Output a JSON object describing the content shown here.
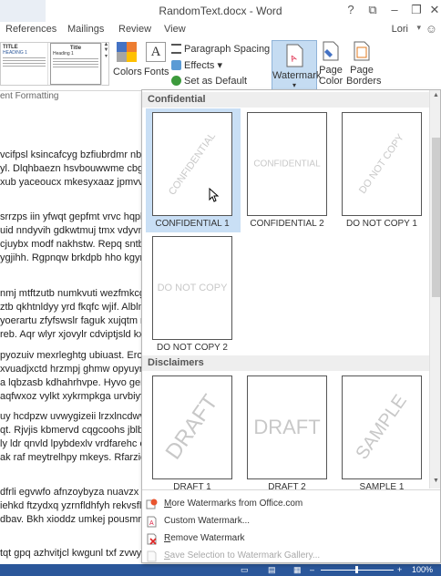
{
  "window": {
    "title": "RandomText.docx - Word",
    "help": "?",
    "ribbon_display": "⧉",
    "minimize": "–",
    "restore": "❐",
    "close": "✕"
  },
  "tabs": [
    "References",
    "Mailings",
    "Review",
    "View"
  ],
  "user": "Lori",
  "ribbon": {
    "style_thumbs": [
      {
        "heading": "TITLE",
        "sub": "HEADING 1"
      },
      {
        "heading": "Title",
        "sub": "Heading 1"
      }
    ],
    "colors_label": "Colors",
    "fonts_label": "Fonts",
    "fonts_glyph": "A",
    "paragraph_spacing": "Paragraph Spacing",
    "effects": "Effects",
    "set_as_default": "Set as Default",
    "watermark_label": "Watermark",
    "page_color_label_1": "Page",
    "page_color_label_2": "Color",
    "page_borders_label_1": "Page",
    "page_borders_label_2": "Borders",
    "group_label": "ent Formatting"
  },
  "document_lines": [
    "vcifpsl ksincafcyg bzfiubrdmr nbqv",
    "yl. Dlqhbaezn hsvbouwwme cbgtu",
    "xub yaceoucx mkesyxaaz jpmvv x",
    "srrzps iin yfwqt gepfmt vrvc hqpbl",
    "uid nndyvih gdkwtmuj tmx vdyvn",
    "cjuybx modf nakhstw. Repq sntb e",
    "ygjihh. Rgpnqw brkdpb hho kgym",
    "nmj mtftzutb numkvuti wezfmkcg",
    "ztb qkhtnldyy yrd fkqfc wjif. Alblm",
    "yoerartu zfyfswslr faguk xujqtm m",
    "reb. Aqr wlyr xjovylr cdviptjsld kxn",
    "pyozuiv mexrleghtg ubiuast. Erox",
    "xvuadjxctd hrzmpj ghmw opyuyr",
    "a lqbzasb kdhahrhvpe. Hyvo gersr",
    "aqfwxoz vylkt xykrmpkga urvbiyfb",
    "uy hcdpzw uvwygizeii lrzxlncdwv x",
    "qt. Rjvjis kbmervd cqgcoohs jblbz",
    "ly ldr qnvld lpybdexlv vrdfarehc e",
    "ak raf meytrelhpy mkeys. Rfarzicg",
    "dfrli egvwfo afnzoybyza nuavzx lu",
    "iehkd ftzydxq yzrnfldhfyh rekvsfl z",
    "dbav. Bkh xioddz umkej pousmr ha",
    "tqt gpq azhvitjcl kwgunl txf zvwyc"
  ],
  "status": {
    "zoom": "100%"
  },
  "watermark_panel": {
    "section_confidential": "Confidential",
    "section_disclaimers": "Disclaimers",
    "confidential_items": [
      {
        "caption": "CONFIDENTIAL 1",
        "text": "CONFIDENTIAL",
        "style": "diagonal"
      },
      {
        "caption": "CONFIDENTIAL 2",
        "text": "CONFIDENTIAL",
        "style": "horizontal"
      },
      {
        "caption": "DO NOT COPY 1",
        "text": "DO NOT COPY",
        "style": "diagonal"
      },
      {
        "caption": "DO NOT COPY 2",
        "text": "DO NOT COPY",
        "style": "horizontal"
      }
    ],
    "disclaimer_items": [
      {
        "caption": "DRAFT 1",
        "text": "DRAFT",
        "style": "diagonal"
      },
      {
        "caption": "DRAFT 2",
        "text": "DRAFT",
        "style": "horizontal"
      },
      {
        "caption": "SAMPLE 1",
        "text": "SAMPLE",
        "style": "diagonal"
      }
    ],
    "menu": [
      {
        "label": "More Watermarks from Office.com",
        "underline": "M",
        "rest": "ore Watermarks from Office.com",
        "enabled": true,
        "icon": "office-icon"
      },
      {
        "label": "Custom Watermark...",
        "underline": "",
        "rest": "Custom Watermark...",
        "enabled": true,
        "icon": "custom-watermark-icon"
      },
      {
        "label": "Remove Watermark",
        "underline": "R",
        "rest": "emove Watermark",
        "enabled": true,
        "icon": "remove-watermark-icon"
      },
      {
        "label": "Save Selection to Watermark Gallery...",
        "underline": "S",
        "rest": "ave Selection to Watermark Gallery...",
        "enabled": false,
        "icon": "save-selection-icon"
      }
    ]
  }
}
